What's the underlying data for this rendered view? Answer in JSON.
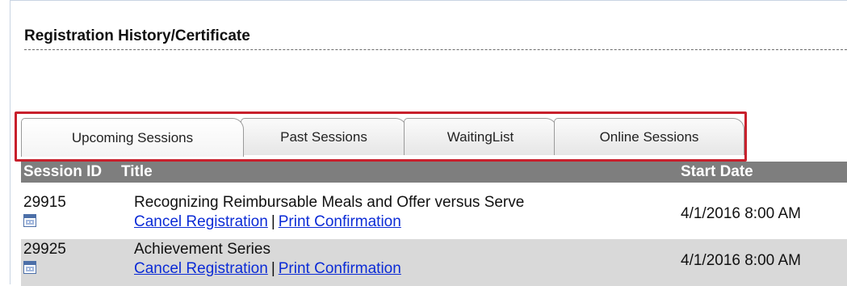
{
  "page": {
    "section_title": "Registration History/Certificate"
  },
  "tabs": [
    {
      "label": "Upcoming Sessions",
      "active": true
    },
    {
      "label": "Past Sessions",
      "active": false
    },
    {
      "label": "WaitingList",
      "active": false
    },
    {
      "label": "Online Sessions",
      "active": false
    }
  ],
  "grid": {
    "headers": {
      "session_id": "Session ID",
      "title": "Title",
      "start_date": "Start Date"
    },
    "rows": [
      {
        "session_id": "29915",
        "title": "Recognizing Reimbursable Meals and Offer versus Serve",
        "start_date": "4/1/2016 8:00 AM",
        "cancel_label": "Cancel Registration",
        "separator": "|",
        "print_label": "Print Confirmation"
      },
      {
        "session_id": "29925",
        "title": "Achievement Series",
        "start_date": "4/1/2016 8:00 AM",
        "cancel_label": "Cancel Registration",
        "separator": "|",
        "print_label": "Print Confirmation"
      }
    ]
  },
  "colors": {
    "highlight": "#c8202c",
    "header_bg": "#7e7e7e",
    "link": "#0b2bd6",
    "alt_row": "#d9d9d9"
  },
  "icons": {
    "calendar": "calendar-icon"
  }
}
